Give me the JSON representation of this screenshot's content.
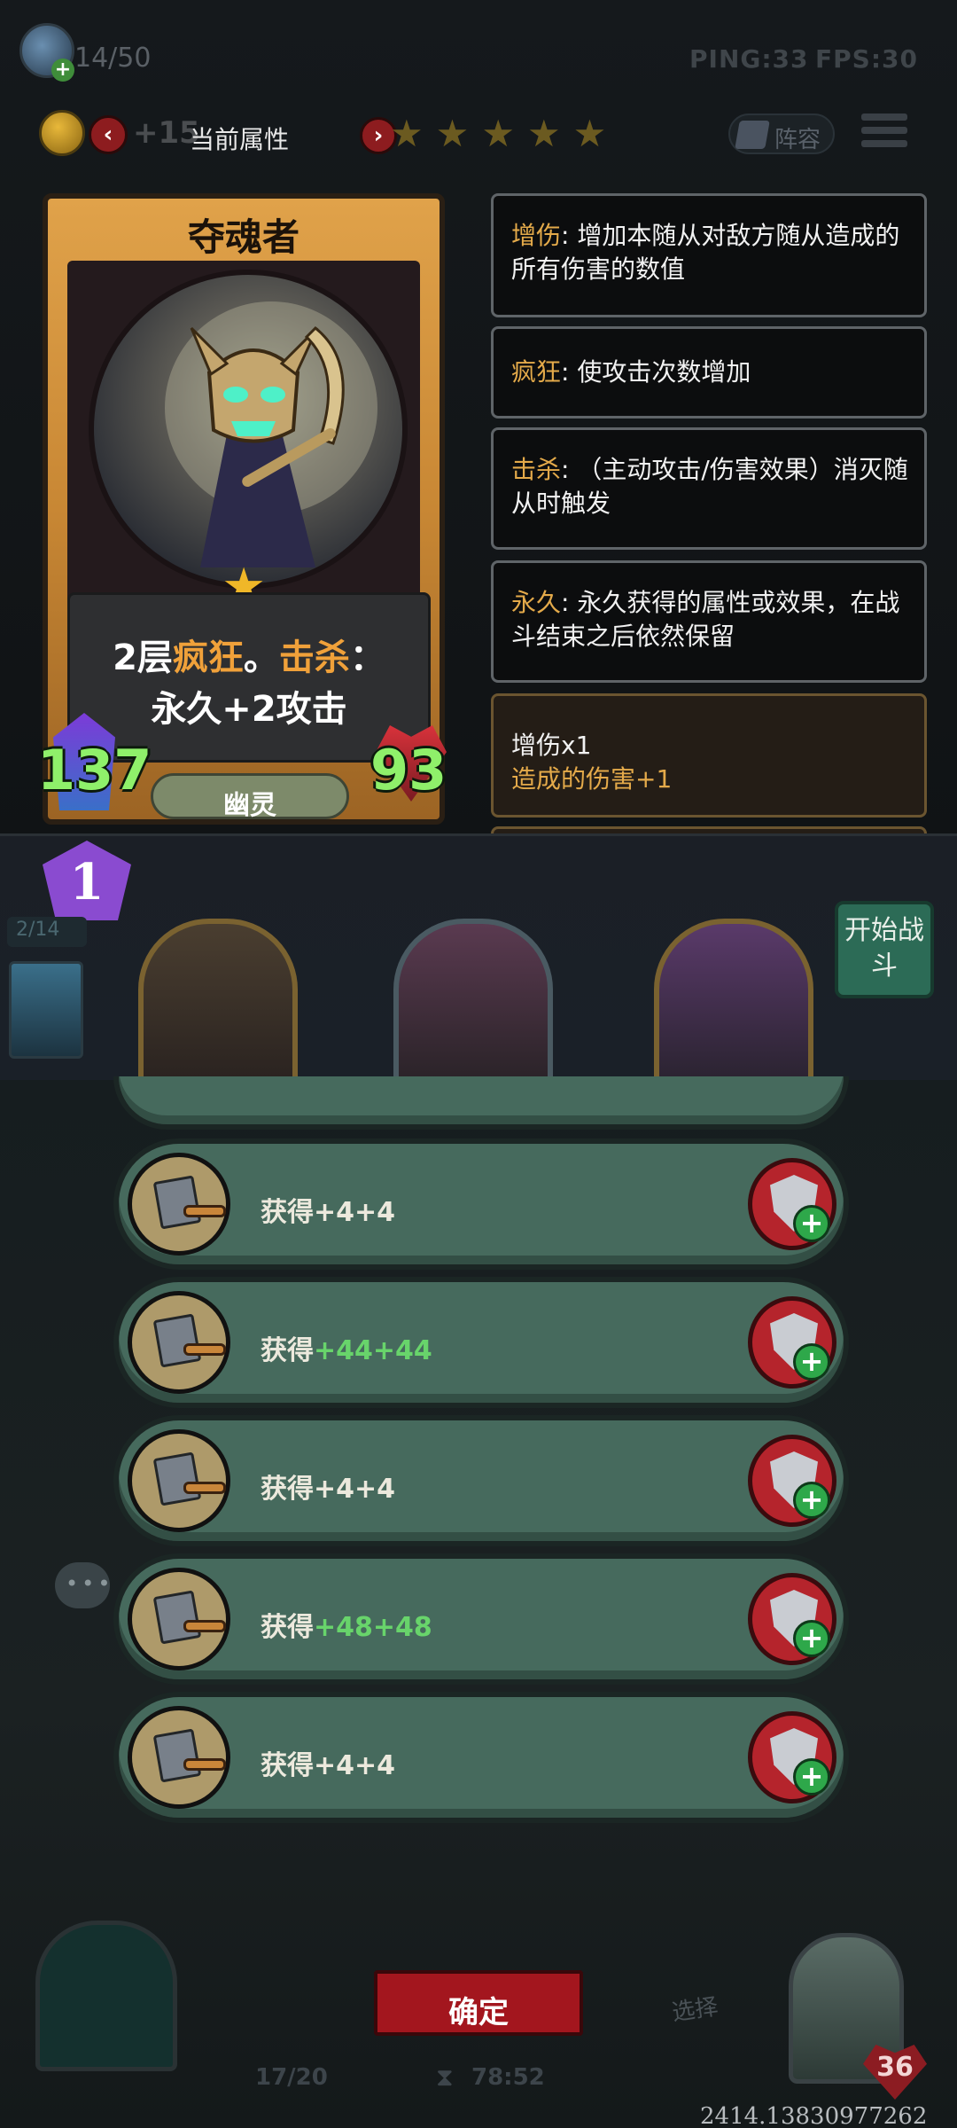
{
  "status": {
    "player_count": "14/50",
    "ping": "PING:33",
    "fps": "FPS:30",
    "coin_bonus": "+15"
  },
  "attribute_header": {
    "title": "当前属性",
    "prev_arrow": "‹",
    "next_arrow": "›",
    "stars": [
      "★",
      "★",
      "★",
      "★",
      "★"
    ],
    "lineup_label": "阵容"
  },
  "card": {
    "name": "夺魂者",
    "star": "★",
    "desc_line1_prefix": "2层",
    "desc_kw1": "疯狂",
    "desc_mid": "。",
    "desc_kw2": "击杀",
    "desc_colon": "：",
    "desc_line2": "永久+2攻击",
    "attack": "137",
    "health": "93",
    "tribe": "幽灵"
  },
  "keywords": [
    {
      "name": "增伤",
      "sep": ": ",
      "desc": "增加本随从对敌方随从造成的所有伤害的数值"
    },
    {
      "name": "疯狂",
      "sep": ": ",
      "desc": "使攻击次数增加"
    },
    {
      "name": "击杀",
      "sep": ": ",
      "desc": "（主动攻击/伤害效果）消灭随从时触发"
    },
    {
      "name": "永久",
      "sep": ": ",
      "desc": "永久获得的属性或效果，在战斗结束之后依然保留"
    }
  ],
  "buff": {
    "line1": "增伤x1",
    "line2": "造成的伤害+1"
  },
  "board": {
    "round": "1",
    "minion_count": "2/14",
    "start_button": "开始战斗"
  },
  "options": [
    {
      "prefix": "获得",
      "attack": "+4",
      "health": "+4",
      "highlight": false
    },
    {
      "prefix": "获得",
      "attack": "+44",
      "health": "+44",
      "highlight": true
    },
    {
      "prefix": "获得",
      "attack": "+4",
      "health": "+4",
      "highlight": false
    },
    {
      "prefix": "获得",
      "attack": "+48",
      "health": "+48",
      "highlight": true
    },
    {
      "prefix": "获得",
      "attack": "+4",
      "health": "+4",
      "highlight": false
    }
  ],
  "footer": {
    "confirm": "确定",
    "deck_count": "17/20",
    "timer": "78:52",
    "select_hint": "选择",
    "level": "36",
    "coordinates": "2414.13830977262"
  },
  "colors": {
    "keyword_gold": "#e4aa4a",
    "number_green": "#68d46b",
    "stat_green": "#8ff06a",
    "confirm_red": "#a3161e"
  }
}
